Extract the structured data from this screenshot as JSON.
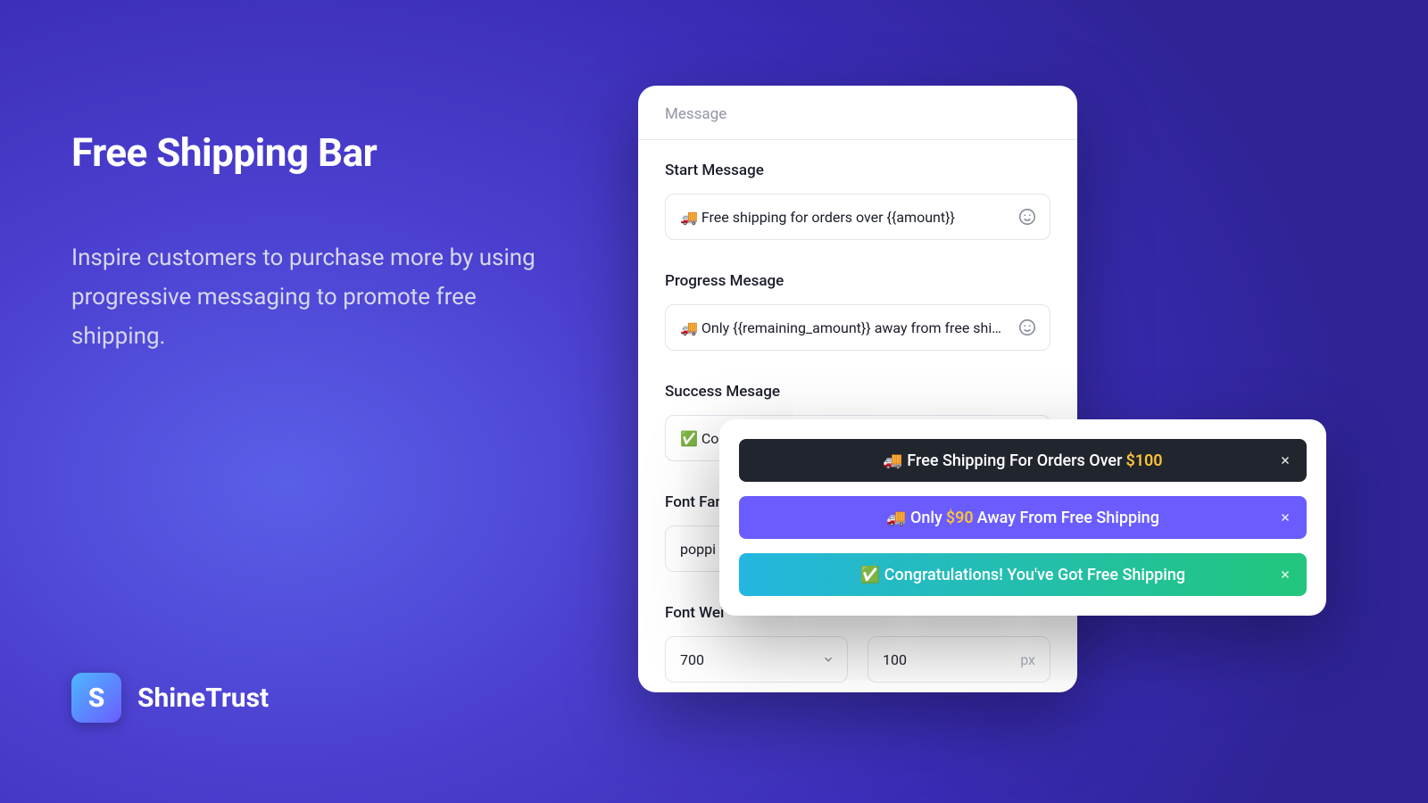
{
  "hero": {
    "title": "Free Shipping Bar",
    "description": "Inspire customers to purchase more by using progressive messaging to promote free shipping."
  },
  "brand": {
    "name": "ShineTrust",
    "initial": "S"
  },
  "form": {
    "section_title": "Message",
    "start_message": {
      "label": "Start Message",
      "value": "🚚 Free shipping for orders over {{amount}}"
    },
    "progress_message": {
      "label": "Progress Mesage",
      "value": "🚚 Only {{remaining_amount}} away from free shipping"
    },
    "success_message": {
      "label": "Success Mesage",
      "value": "✅ Con"
    },
    "font_family": {
      "label": "Font Fam",
      "value": "poppi"
    },
    "font_weight": {
      "label": "Font Wei",
      "value": "700"
    },
    "size": {
      "value": "100",
      "unit": "px"
    }
  },
  "preview": {
    "bar1_prefix": "🚚 Free Shipping For Orders Over",
    "bar1_amount": "$100",
    "bar2_prefix": "🚚 Only",
    "bar2_amount": "$90",
    "bar2_suffix": "Away From Free Shipping",
    "bar3_text": "✅ Congratulations! You've Got Free Shipping"
  }
}
